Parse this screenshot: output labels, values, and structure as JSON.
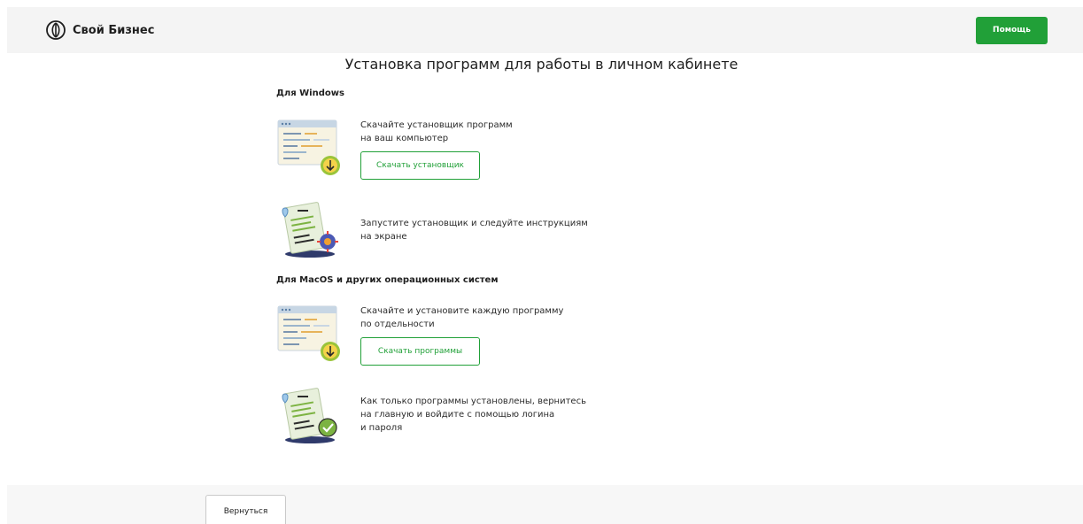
{
  "header": {
    "brand_name": "Свой Бизнес",
    "help_label": "Помощь"
  },
  "page_title": "Установка программ для работы в личном кабинете",
  "sections": [
    {
      "heading": "Для Windows",
      "steps": [
        {
          "line1": "Скачайте установщик программ",
          "line2": "на ваш компьютер",
          "button": "Скачать установщик",
          "icon": "download-window-icon"
        },
        {
          "line1": "Запустите установщик и следуйте инструкциям",
          "line2": "на экране",
          "icon": "document-gear-icon"
        }
      ]
    },
    {
      "heading": "Для MacOS и других операционных систем",
      "steps": [
        {
          "line1": "Скачайте и установите каждую программу",
          "line2": "по отдельности",
          "button": "Скачать программы",
          "icon": "download-window-icon"
        },
        {
          "line1": "Как только программы установлены, вернитесь",
          "line2": "на главную и войдите с помощью логина",
          "line3": "и пароля",
          "icon": "document-check-icon"
        }
      ]
    }
  ],
  "footer": {
    "back_label": "Вернуться"
  },
  "colors": {
    "accent": "#21a038",
    "header_bg": "#f4f4f4"
  }
}
